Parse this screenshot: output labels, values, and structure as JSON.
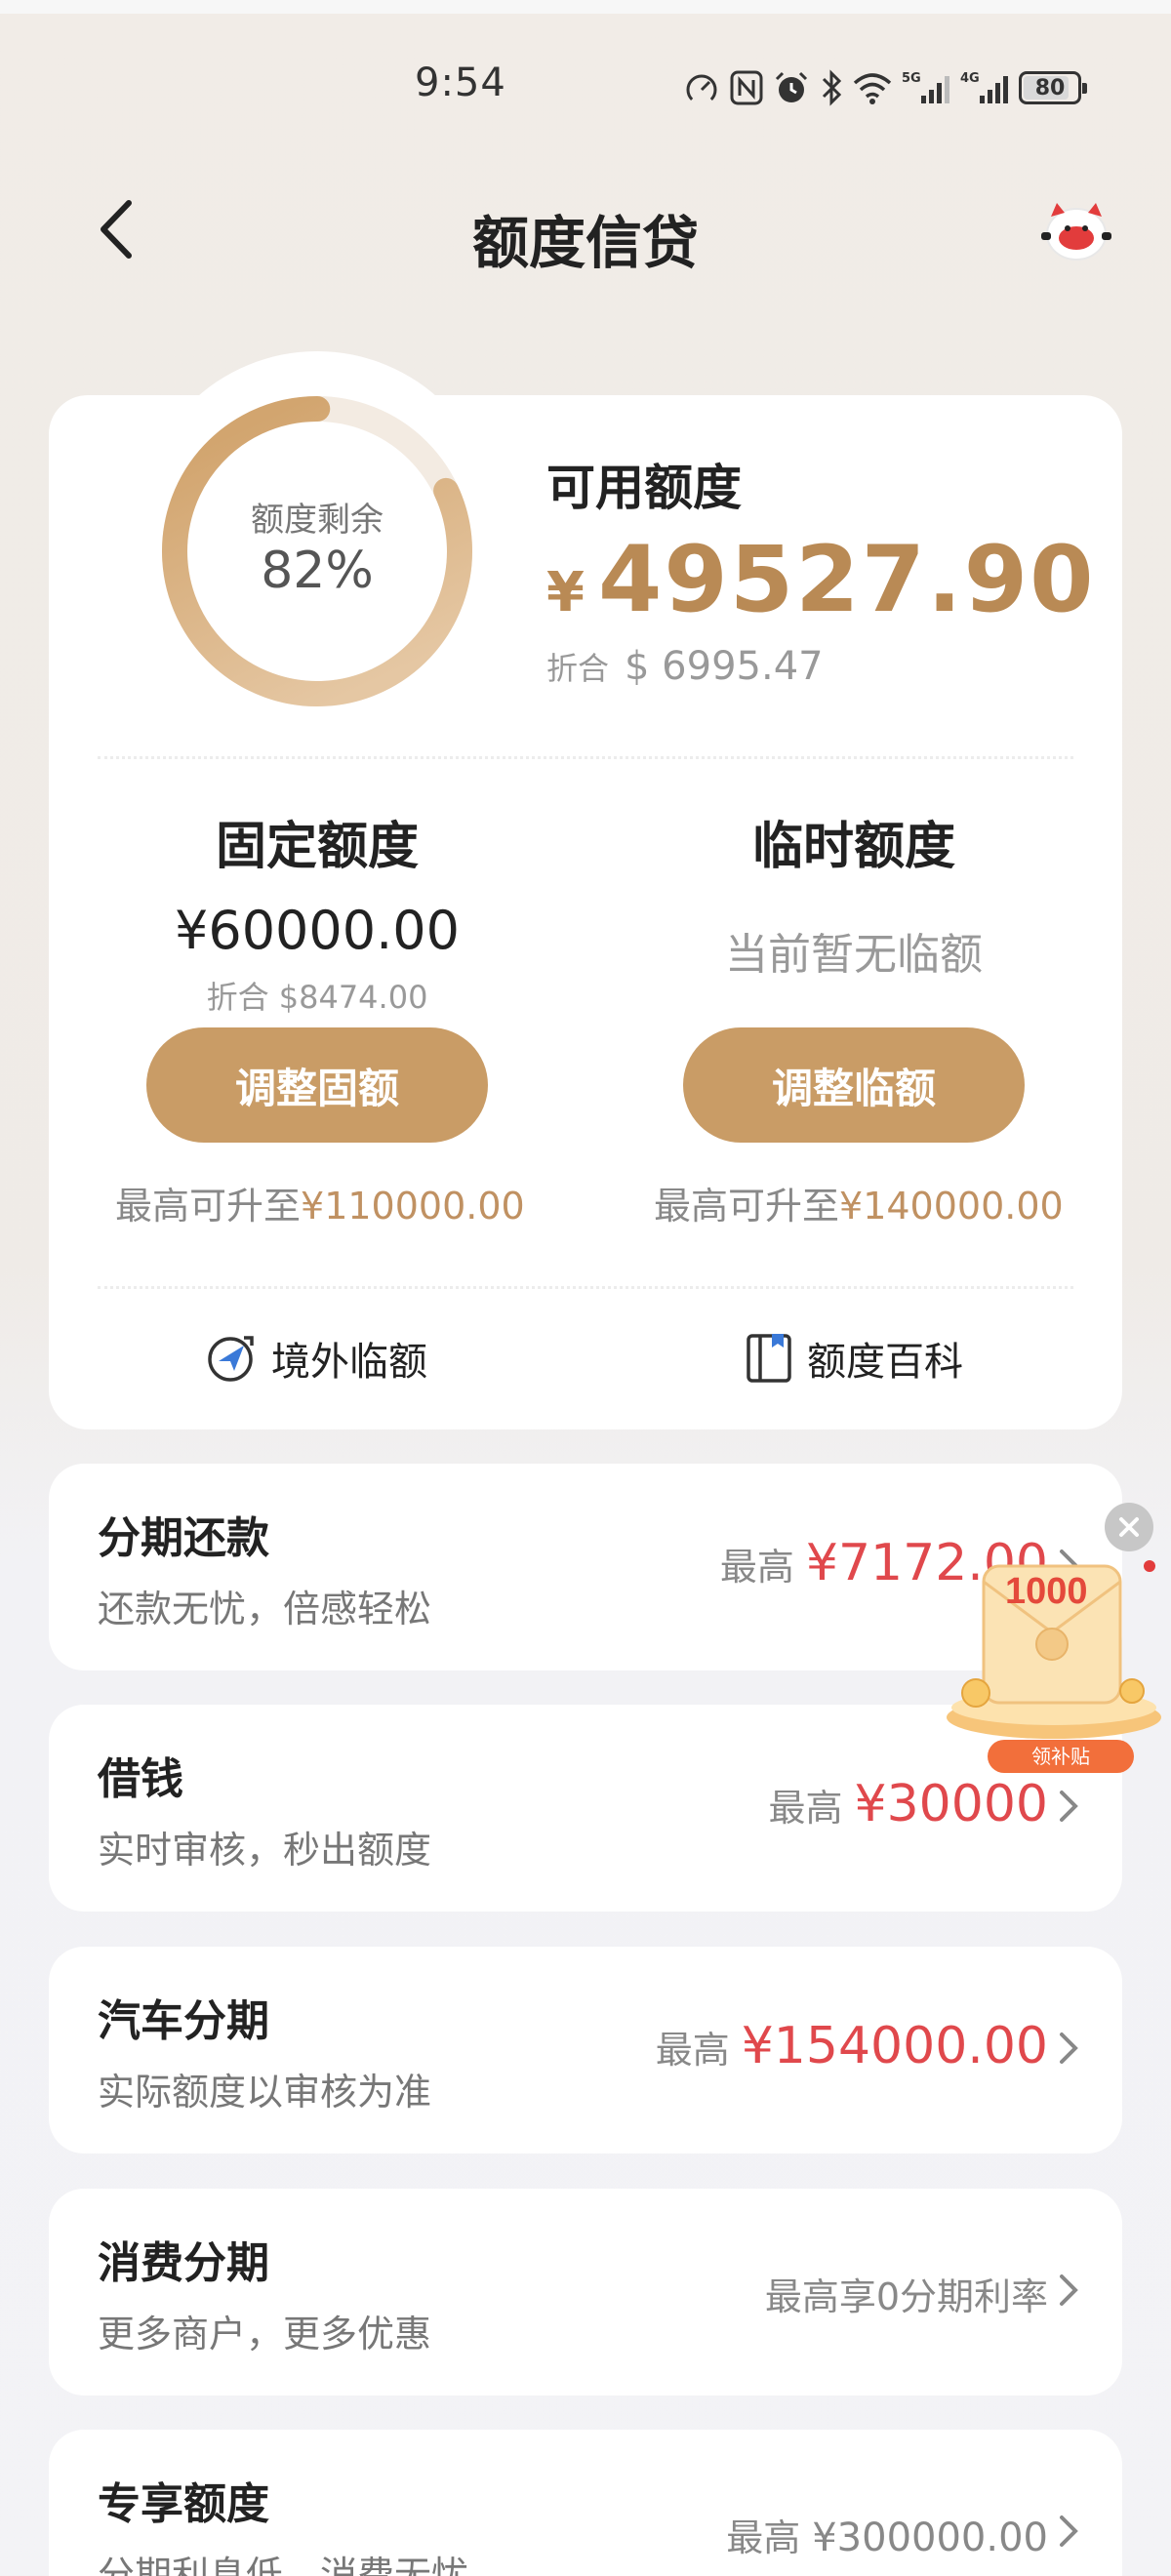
{
  "status_bar": {
    "time": "9:54",
    "battery": "80",
    "network_1": "5G",
    "network_2": "4G"
  },
  "header": {
    "title": "额度信贷",
    "back_icon": "chevron-left-icon",
    "mascot_icon": "mascot-icon"
  },
  "credit": {
    "ring_label": "额度剩余",
    "ring_percent_text": "82%",
    "remaining_fraction": 0.82,
    "available_title": "可用额度",
    "available_currency": "¥",
    "available_amount": "49527.90",
    "usd_label": "折合",
    "usd_value": "$ 6995.47",
    "fixed": {
      "title": "固定额度",
      "amount": "¥60000.00",
      "usd": "折合 $8474.00",
      "button": "调整固额",
      "max_prefix": "最高可升至",
      "max_value": "¥110000.00"
    },
    "temporary": {
      "title": "临时额度",
      "status": "当前暂无临额",
      "button": "调整临额",
      "max_prefix": "最高可升至",
      "max_value": "¥140000.00"
    },
    "links": [
      {
        "label": "境外临额",
        "icon": "globe-plane-icon"
      },
      {
        "label": "额度百科",
        "icon": "book-icon"
      }
    ]
  },
  "services": [
    {
      "title": "分期还款",
      "subtitle": "还款无忧，倍感轻松",
      "prefix": "最高",
      "value": "¥7172.00"
    },
    {
      "title": "借钱",
      "subtitle": "实时审核，秒出额度",
      "prefix": "最高",
      "value": "¥30000"
    },
    {
      "title": "汽车分期",
      "subtitle": "实际额度以审核为准",
      "prefix": "最高",
      "value": "¥154000.00"
    },
    {
      "title": "消费分期",
      "subtitle": "更多商户，更多优惠",
      "text": "最高享0分期利率"
    },
    {
      "title": "专享额度",
      "subtitle": "分期利息低，消费无忧",
      "prefix": "最高",
      "value": "¥300000.00"
    }
  ],
  "promo": {
    "amount": "1000",
    "label": "领补贴"
  },
  "colors": {
    "gold": "#c99c66",
    "gold_text": "#b98a55",
    "red": "#e0484c"
  }
}
